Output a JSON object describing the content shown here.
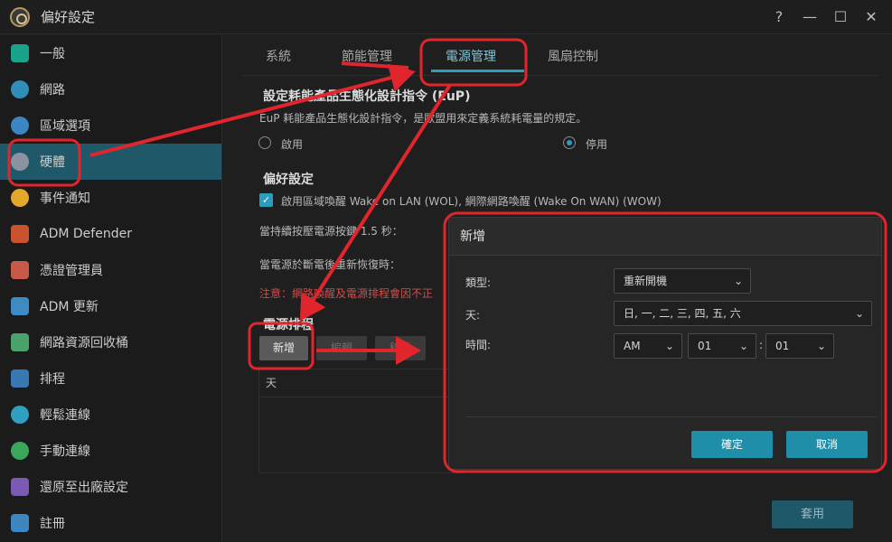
{
  "window": {
    "title": "偏好設定",
    "controls": [
      "?",
      "—",
      "☐",
      "✕"
    ]
  },
  "sidebar": {
    "items": [
      {
        "label": "一般",
        "icon": "general-icon",
        "active": false
      },
      {
        "label": "網路",
        "icon": "globe-icon",
        "active": false
      },
      {
        "label": "區域選項",
        "icon": "region-icon",
        "active": false
      },
      {
        "label": "硬體",
        "icon": "hardware-icon",
        "active": true
      },
      {
        "label": "事件通知",
        "icon": "alert-icon",
        "active": false
      },
      {
        "label": "ADM Defender",
        "icon": "firewall-icon",
        "active": false
      },
      {
        "label": "憑證管理員",
        "icon": "certificate-icon",
        "active": false
      },
      {
        "label": "ADM 更新",
        "icon": "update-icon",
        "active": false
      },
      {
        "label": "網路資源回收桶",
        "icon": "recycle-bin-icon",
        "active": false
      },
      {
        "label": "排程",
        "icon": "schedule-icon",
        "active": false
      },
      {
        "label": "輕鬆連線",
        "icon": "cloud-connect-icon",
        "active": false
      },
      {
        "label": "手動連線",
        "icon": "manual-connect-icon",
        "active": false
      },
      {
        "label": "還原至出廠設定",
        "icon": "restore-icon",
        "active": false
      },
      {
        "label": "註冊",
        "icon": "register-icon",
        "active": false
      }
    ]
  },
  "tabs": [
    {
      "label": "系統",
      "active": false
    },
    {
      "label": "節能管理",
      "active": false
    },
    {
      "label": "電源管理",
      "active": true
    },
    {
      "label": "風扇控制",
      "active": false
    }
  ],
  "eup": {
    "title": "設定耗能產品生態化設計指令 (EuP)",
    "description": "EuP 耗能產品生態化設計指令，是歐盟用來定義系統耗電量的規定。",
    "option_enable": "啟用",
    "option_disable": "停用",
    "selected": "停用"
  },
  "prefs": {
    "title": "偏好設定",
    "wol_label": "啟用區域喚醒 Wake on LAN (WOL), 網際網路喚醒 (Wake On WAN) (WOW)",
    "wol_checked": true,
    "power_button_text": "當持續按壓電源按鍵 1.5 秒：",
    "power_restore_text": "當電源於斷電後重新恢復時：",
    "warning_text": "注意：網路喚醒及電源排程會因不正"
  },
  "schedule": {
    "title": "電源排程",
    "add_label": "新增",
    "edit_label": "編輯",
    "delete_label": "移除",
    "column_day": "天"
  },
  "apply_label": "套用",
  "dialog": {
    "title": "新增",
    "type_label": "類型:",
    "type_value": "重新開機",
    "day_label": "天:",
    "day_value": "日, 一, 二, 三, 四, 五, 六",
    "time_label": "時間:",
    "ampm_value": "AM",
    "hour_value": "01",
    "minute_value": "01",
    "time_separator": ":",
    "ok_label": "確定",
    "cancel_label": "取消"
  },
  "colors": {
    "accent": "#2a9fbd",
    "active_sidebar": "#1f5869",
    "annotation": "#e0262c",
    "warning": "#d14b4b"
  }
}
